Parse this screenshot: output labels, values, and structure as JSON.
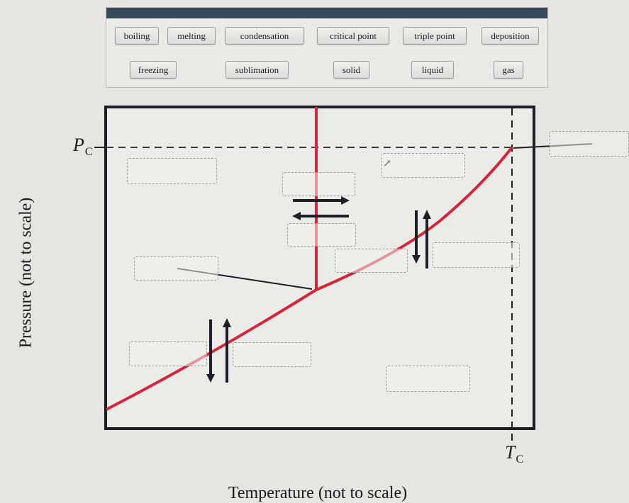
{
  "word_bank": {
    "row1": [
      "boiling",
      "melting",
      "condensation",
      "critical point",
      "triple point",
      "deposition"
    ],
    "row2": [
      "freezing",
      "sublimation",
      "solid",
      "liquid",
      "gas"
    ]
  },
  "diagram": {
    "title_type": "phase diagram",
    "x_axis_label": "Temperature (not to scale)",
    "y_axis_label": "Pressure (not to scale)",
    "pc_symbol": "P",
    "pc_subscript": "C",
    "tc_symbol": "T",
    "tc_subscript": "C",
    "curve_color": "#d8243a",
    "drop_targets": [
      {
        "id": "region-upper-left",
        "value": ""
      },
      {
        "id": "region-top-middle",
        "value": ""
      },
      {
        "id": "region-upper-right",
        "value": ""
      },
      {
        "id": "arrow-right-label",
        "value": ""
      },
      {
        "id": "arrow-left-label",
        "value": ""
      },
      {
        "id": "critical-point-label",
        "value": ""
      },
      {
        "id": "triple-point-label",
        "value": ""
      },
      {
        "id": "liquid-gas-down-label",
        "value": ""
      },
      {
        "id": "liquid-gas-up-label",
        "value": ""
      },
      {
        "id": "solid-gas-down-label",
        "value": ""
      },
      {
        "id": "solid-gas-up-label",
        "value": ""
      },
      {
        "id": "region-bottom-right",
        "value": ""
      }
    ]
  }
}
